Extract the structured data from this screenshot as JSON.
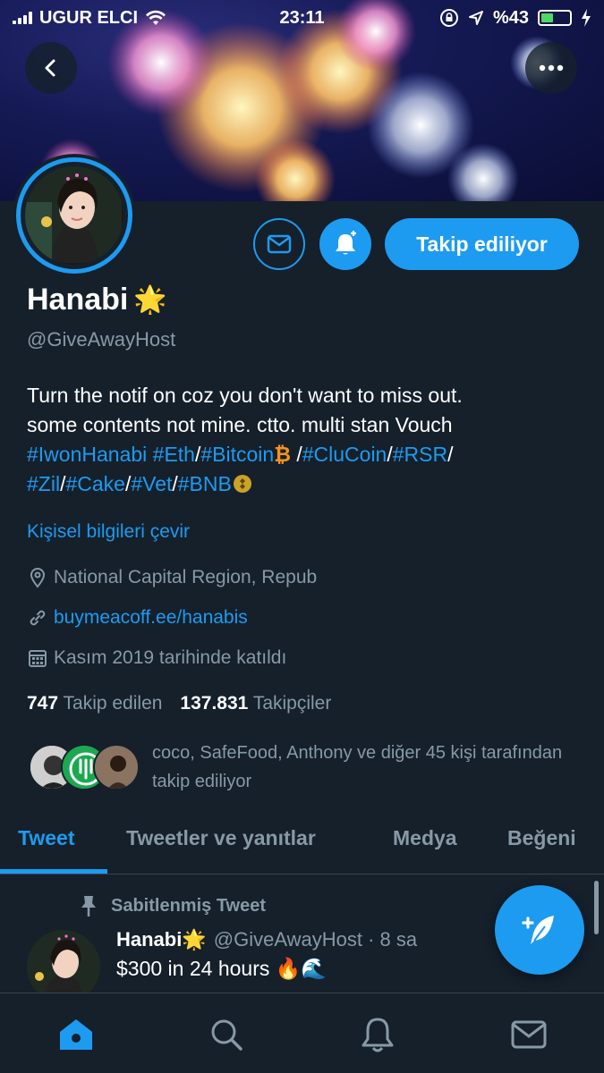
{
  "status_bar": {
    "carrier": "UGUR ELCI",
    "time": "23:11",
    "battery_percent": "%43",
    "battery_level": 0.43
  },
  "header": {
    "back_icon": "back-arrow-icon",
    "more_icon": "more-dots-icon"
  },
  "profile": {
    "name": "Hanabi",
    "name_emoji": "🌟",
    "handle": "@GiveAwayHost",
    "follow_button": "Takip ediliyor",
    "bio": {
      "line1": "Turn the notif on coz you don't want to miss out.",
      "line2": "some contents not mine. ctto. multi stan Vouch",
      "tags": [
        "#IwonHanabi",
        "#Eth",
        "#Bitcoin",
        "#CluCoin",
        "#RSR",
        "#Zil",
        "#Cake",
        "#Vet",
        "#BNB"
      ],
      "separator": "/",
      "bitcoin_emoji": "₿"
    },
    "translate": "Kişisel bilgileri çevir",
    "location": "National Capital Region, Repub",
    "website": "buymeacoff.ee/hanabis",
    "joined": "Kasım 2019 tarihinde katıldı",
    "following_count": "747",
    "following_label": "Takip edilen",
    "followers_count": "137.831",
    "followers_label": "Takipçiler",
    "followed_by": "coco, SafeFood, Anthony ve diğer 45 kişi tarafından takip ediliyor"
  },
  "tabs": [
    "Tweet",
    "Tweetler ve yanıtlar",
    "Medya",
    "Beğeni"
  ],
  "pinned_tweet": {
    "label": "Sabitlenmiş Tweet",
    "author": "Hanabi",
    "author_emoji": "🌟",
    "handle_time": "@GiveAwayHost · 8 sa",
    "text": "$300 in 24 hours 🔥🌊"
  },
  "colors": {
    "accent": "#1d9bf0",
    "background": "#15202b",
    "muted": "#8899a6"
  },
  "bottom_nav": [
    "home-icon",
    "search-icon",
    "notifications-icon",
    "messages-icon"
  ]
}
